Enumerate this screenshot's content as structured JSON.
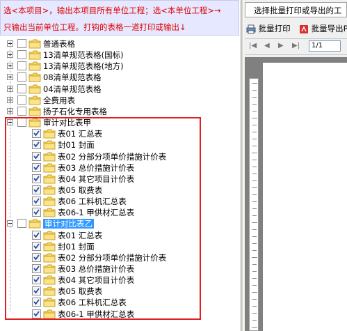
{
  "hint": {
    "line1": "选<本项目>，输出本项目所有单位工程；选<本单位工程>→",
    "line2": "只输出当前单位工程。打钩的表格一道打印或输出↓"
  },
  "tree": {
    "top_groups": [
      {
        "label": "普通表格"
      },
      {
        "label": "13清单规范表格(国标)"
      },
      {
        "label": "13清单规范表格(地方)"
      },
      {
        "label": "08清单规范表格"
      },
      {
        "label": "04清单规范表格"
      },
      {
        "label": "全费用表"
      },
      {
        "label": "扬子石化专用表格"
      }
    ],
    "audit_a": {
      "label": "审计对比表甲",
      "items": [
        "表01 汇总表",
        "封01 封面",
        "表02 分部分项单价措施计价表",
        "表03 总价措施计价表",
        "表04 其它项目计价表",
        "表05 取费表",
        "表06 工料机汇总表",
        "表06-1 甲供材汇总表"
      ]
    },
    "audit_b": {
      "label": "审计对比表乙",
      "items": [
        "表01 汇总表",
        "封01 封面",
        "表02 分部分项单价措施计价表",
        "表03 总价措施计价表",
        "表04 其它项目计价表",
        "表05 取费表",
        "表06 工料机汇总表",
        "表06-1 甲供材汇总表"
      ]
    }
  },
  "right_panel": {
    "title": "选择批量打印或导出的工",
    "batch_print": "批量打印",
    "batch_export": "批量导出P",
    "page_indicator": "1/1"
  },
  "colors": {
    "accent_red": "#e02020",
    "selection": "#3399ff",
    "hint_bg": "#e6e8ff"
  }
}
